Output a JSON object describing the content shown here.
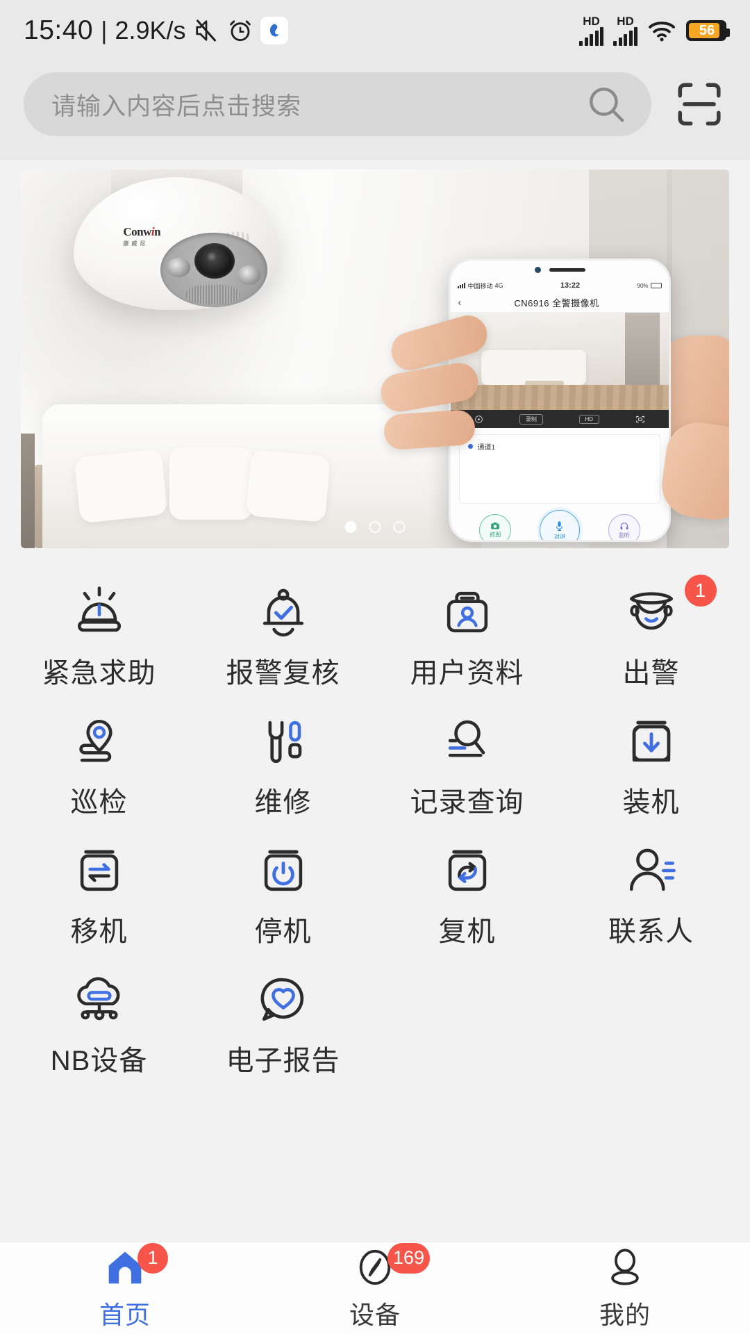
{
  "statusbar": {
    "time": "15:40",
    "separator": "|",
    "netspeed": "2.9K/s",
    "icons": [
      "mute-icon",
      "alarm-clock-icon",
      "app-icon"
    ],
    "hd_label_1": "HD",
    "hd_label_2": "HD",
    "battery_level": "56"
  },
  "search": {
    "placeholder": "请输入内容后点击搜索",
    "search_icon": "search-icon",
    "scan_icon": "scan-qr-icon"
  },
  "banner": {
    "carousel_dots": 3,
    "active_dot": 1,
    "camera_brand": "Conwin",
    "camera_brand_sub": "康威尼",
    "mock": {
      "carrier": "中国移动",
      "network": "4G",
      "time": "13:22",
      "battery": "90%",
      "title": "CN6916 全警摄像机",
      "back_icon": "back-chevron-icon",
      "toolbar": {
        "ptz_label": "ptz-icon",
        "record_label": "录制",
        "quality_label": "HD",
        "fullscreen_label": "fullscreen-icon"
      },
      "channel_label": "通道1",
      "actions": [
        {
          "label": "抓图",
          "icon": "camera-icon",
          "color": "#31a07c"
        },
        {
          "label": "对讲",
          "icon": "microphone-icon",
          "color": "#2b8fd9"
        },
        {
          "label": "监听",
          "icon": "headphone-icon",
          "color": "#7b73cf"
        }
      ]
    }
  },
  "grid": {
    "items": [
      {
        "label": "紧急求助",
        "icon": "siren-alarm-icon",
        "badge": null
      },
      {
        "label": "报警复核",
        "icon": "bell-check-icon",
        "badge": null
      },
      {
        "label": "用户资料",
        "icon": "briefcase-user-icon",
        "badge": null
      },
      {
        "label": "出警",
        "icon": "police-officer-icon",
        "badge": "1"
      },
      {
        "label": "巡检",
        "icon": "location-route-icon",
        "badge": null
      },
      {
        "label": "维修",
        "icon": "wrench-tool-icon",
        "badge": null
      },
      {
        "label": "记录查询",
        "icon": "magnifier-records-icon",
        "badge": null
      },
      {
        "label": "装机",
        "icon": "box-download-icon",
        "badge": null
      },
      {
        "label": "移机",
        "icon": "box-transfer-icon",
        "badge": null
      },
      {
        "label": "停机",
        "icon": "box-power-icon",
        "badge": null
      },
      {
        "label": "复机",
        "icon": "box-restore-icon",
        "badge": null
      },
      {
        "label": "联系人",
        "icon": "person-contact-icon",
        "badge": null
      },
      {
        "label": "NB设备",
        "icon": "cloud-network-icon",
        "badge": null
      },
      {
        "label": "电子报告",
        "icon": "chat-heart-icon",
        "badge": null
      }
    ]
  },
  "tabbar": {
    "items": [
      {
        "label": "首页",
        "icon": "home-icon",
        "badge": "1",
        "active": true
      },
      {
        "label": "设备",
        "icon": "compass-device-icon",
        "badge": "169",
        "active": false
      },
      {
        "label": "我的",
        "icon": "person-profile-icon",
        "badge": null,
        "active": false
      }
    ]
  },
  "colors": {
    "accent_blue": "#3f6fe0",
    "icon_dark": "#2b2b2b",
    "badge_red": "#f7554a",
    "header_bg": "#e9e9e9",
    "page_bg": "#f2f2f2",
    "search_bg": "#d8d8d8",
    "battery_orange": "#f5a623"
  }
}
